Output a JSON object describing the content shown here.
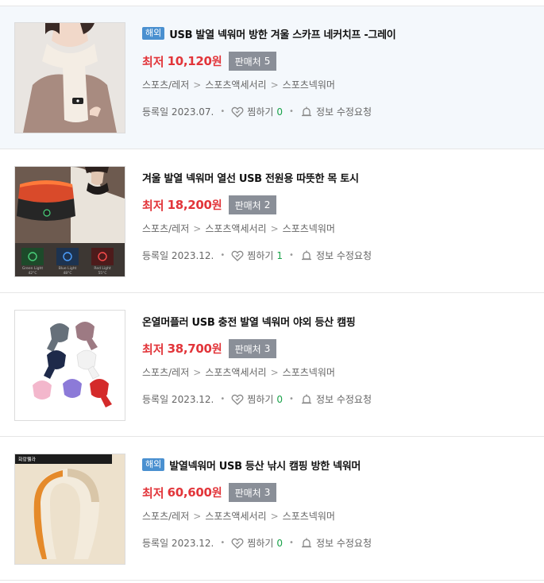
{
  "items": [
    {
      "badge": "해외",
      "title": "USB 발열 넥워머 방한 겨울 스카프 네커치프 -그레이",
      "price_label": "최저",
      "price": "10,120",
      "unit": "원",
      "seller_label": "판매처",
      "seller_count": "5",
      "category": [
        "스포츠/레저",
        "스포츠액세서리",
        "스포츠넥워머"
      ],
      "category_sep": ">",
      "reg": "등록일 2023.07.",
      "fav_label": "찜하기",
      "fav_count": "0",
      "edit_label": "정보 수정요청"
    },
    {
      "badge": "",
      "title": "겨울 발열 넥워머 열선 USB 전원용 따뜻한 목 토시",
      "price_label": "최저",
      "price": "18,200",
      "unit": "원",
      "seller_label": "판매처",
      "seller_count": "2",
      "category": [
        "스포츠/레저",
        "스포츠액세서리",
        "스포츠넥워머"
      ],
      "category_sep": ">",
      "reg": "등록일 2023.12.",
      "fav_label": "찜하기",
      "fav_count": "1",
      "edit_label": "정보 수정요청",
      "thumb_labels": [
        "Green Light",
        "Blue Light",
        "Red Light"
      ],
      "thumb_temps": [
        "42°C",
        "48°C",
        "55°C"
      ]
    },
    {
      "badge": "",
      "title": "온열머플러 USB 충전 발열 넥워머 야외 등산 캠핑",
      "price_label": "최저",
      "price": "38,700",
      "unit": "원",
      "seller_label": "판매처",
      "seller_count": "3",
      "category": [
        "스포츠/레저",
        "스포츠액세서리",
        "스포츠넥워머"
      ],
      "category_sep": ">",
      "reg": "등록일 2023.12.",
      "fav_label": "찜하기",
      "fav_count": "0",
      "edit_label": "정보 수정요청"
    },
    {
      "badge": "해외",
      "title": "발열넥워머 USB 등산 낚시 캠핑 방한 넥워머",
      "price_label": "최저",
      "price": "60,600",
      "unit": "원",
      "seller_label": "판매처",
      "seller_count": "3",
      "category": [
        "스포츠/레저",
        "스포츠액세서리",
        "스포츠넥워머"
      ],
      "category_sep": ">",
      "reg": "등록일 2023.12.",
      "fav_label": "찜하기",
      "fav_count": "0",
      "edit_label": "정보 수정요청",
      "thumb_tag": "화랑웰라"
    }
  ],
  "colors": {
    "price": "#e2353a",
    "badge": "#4a90d0",
    "seller_bg": "#8a8f98",
    "fav_count": "#1aa34a",
    "highlight_bg": "#f4f8fc"
  },
  "icons": {
    "favorite": "heart-icon",
    "edit": "bell-icon"
  }
}
